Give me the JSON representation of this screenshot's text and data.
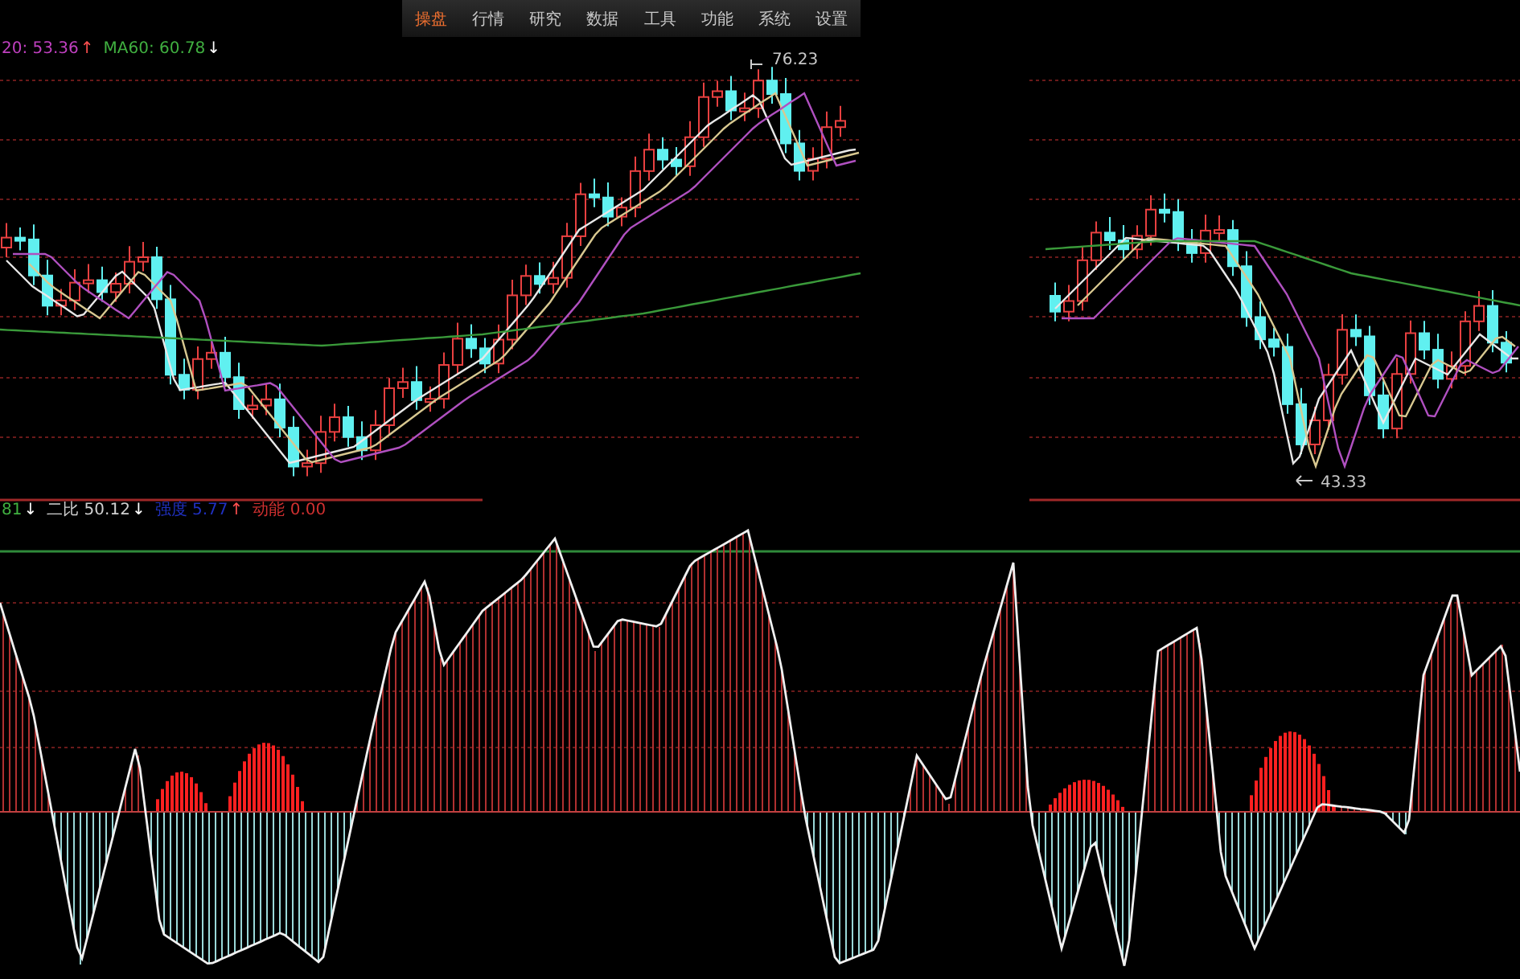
{
  "menu": [
    {
      "label": "操盘",
      "selected": true
    },
    {
      "label": "行情",
      "selected": false
    },
    {
      "label": "研究",
      "selected": false
    },
    {
      "label": "数据",
      "selected": false
    },
    {
      "label": "工具",
      "selected": false
    },
    {
      "label": "功能",
      "selected": false
    },
    {
      "label": "系统",
      "selected": false
    },
    {
      "label": "设置",
      "selected": false
    }
  ],
  "ma_legend": [
    {
      "text": "20: 53.36",
      "arrow": {
        "text": "↑",
        "color": "#ff5050"
      },
      "color": "#c040c0"
    },
    {
      "text": "MA60: 60.78",
      "arrow": {
        "text": "↓",
        "color": "#ffffff"
      },
      "color": "#40b040"
    }
  ],
  "price_labels": [
    {
      "text": "76.23"
    },
    {
      "text": "43.33"
    }
  ],
  "indicator_legend": [
    {
      "text": "81",
      "arrow": {
        "text": "↓",
        "color": "#ffffff"
      },
      "color": "#40b040"
    },
    {
      "text": "二比 50.12",
      "arrow": {
        "text": "↓",
        "color": "#ffffff"
      },
      "color": "#d0d0d0"
    },
    {
      "text": "强度 5.77",
      "arrow": {
        "text": "↑",
        "color": "#ff5050"
      },
      "color": "#2030c0"
    },
    {
      "text": "动能 0.00",
      "color": "#d03030"
    }
  ]
}
